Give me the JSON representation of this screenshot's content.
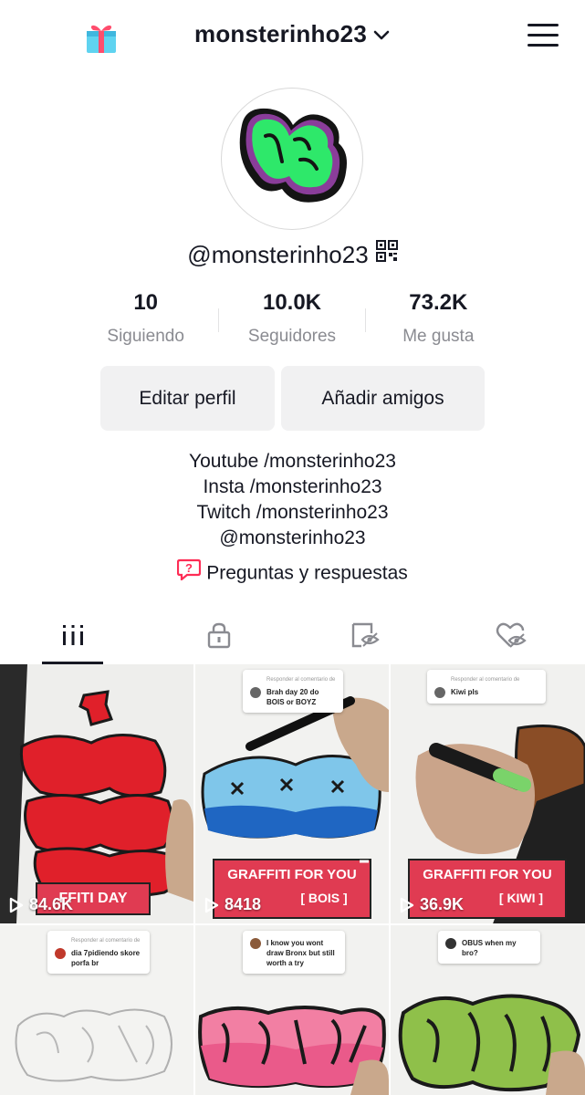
{
  "header": {
    "username": "monsterinho23",
    "gift_icon": "gift-icon",
    "menu_icon": "hamburger-menu-icon"
  },
  "profile": {
    "handle": "@monsterinho23",
    "avatar": "graffiti-m-avatar"
  },
  "stats": [
    {
      "value": "10",
      "label": "Siguiendo"
    },
    {
      "value": "10.0K",
      "label": "Seguidores"
    },
    {
      "value": "73.2K",
      "label": "Me gusta"
    }
  ],
  "buttons": {
    "edit": "Editar perfil",
    "add_friends": "Añadir amigos"
  },
  "bio": [
    "Youtube /monsterinho23",
    "Insta /monsterinho23",
    "Twitch /monsterinho23",
    "@monsterinho23"
  ],
  "qa_label": "Preguntas y respuestas",
  "tabs": [
    "videos-grid-icon",
    "private-lock-icon",
    "reposts-eye-icon",
    "liked-heart-icon"
  ],
  "videos": [
    {
      "plays": "84.6K",
      "banner": "FFITI DAY"
    },
    {
      "plays": "8418",
      "banner_title": "GRAFFITI FOR YOU",
      "banner_sub": "[ BOIS ]",
      "comment_head": "Responder al comentario de",
      "comment": "Brah day 20 do BOIS or BOYZ"
    },
    {
      "plays": "36.9K",
      "banner_title": "GRAFFITI FOR YOU",
      "banner_sub": "[ KIWI ]",
      "comment_head": "Responder al comentario de",
      "comment": "Kiwi pls"
    },
    {
      "comment_head": "Responder al comentario de",
      "comment": "dia 7pidiendo skore porfa br"
    },
    {
      "comment": "I know you wont draw Bronx but still worth a try"
    },
    {
      "comment": "OBUS when my bro?"
    }
  ],
  "colors": {
    "text": "#161823",
    "muted": "#8a8b91",
    "button_bg": "#f1f1f2",
    "accent": "#fe2c55",
    "avatar_green": "#2ee86a",
    "avatar_purple": "#8a3d9a"
  }
}
